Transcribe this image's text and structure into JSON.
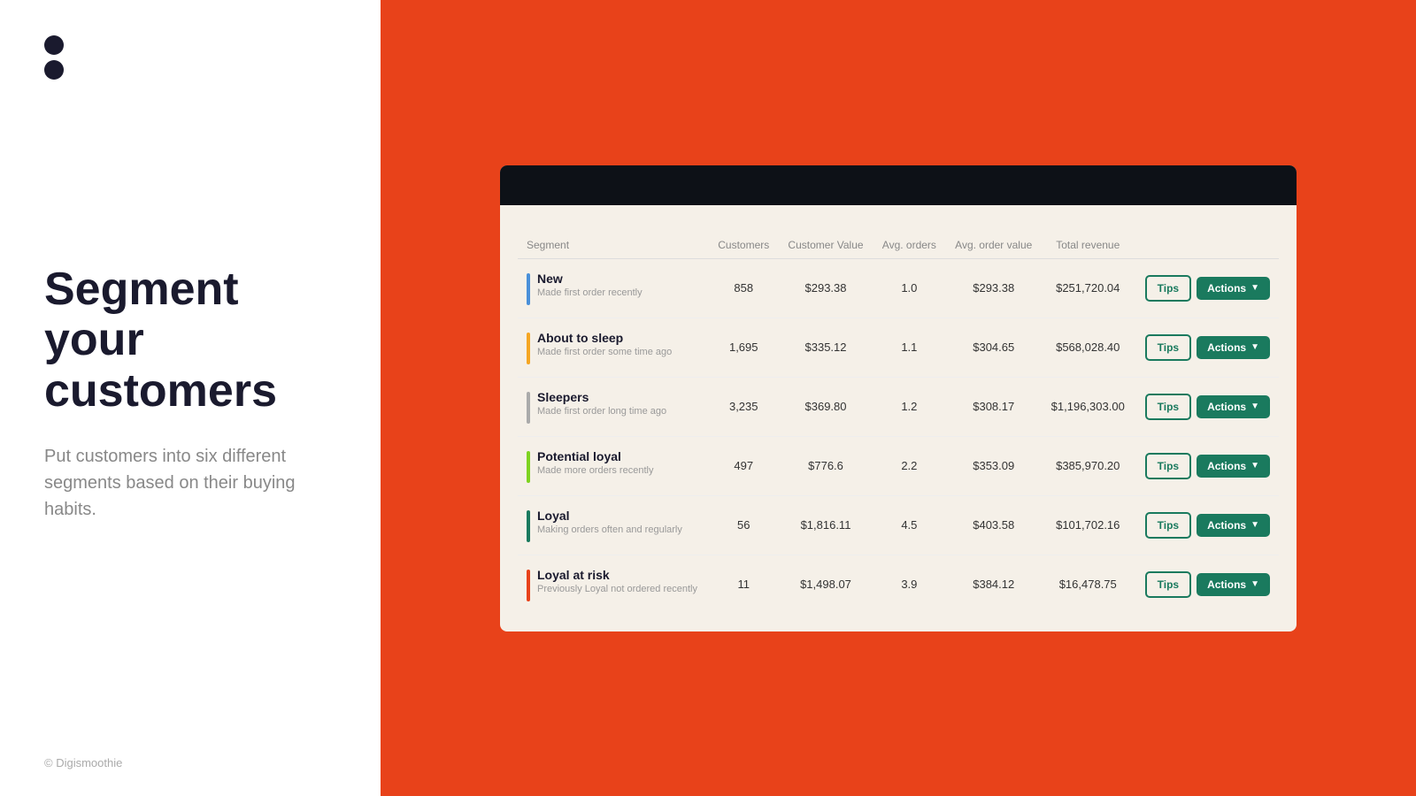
{
  "left": {
    "logo_alt": "Digismoothie logo",
    "heading": "Segment your customers",
    "subtext": "Put customers into six different segments based on their buying habits.",
    "footer": "© Digismoothie"
  },
  "table": {
    "columns": [
      "Segment",
      "Customers",
      "Customer Value",
      "Avg. orders",
      "Avg. order value",
      "Total revenue"
    ],
    "rows": [
      {
        "name": "New",
        "desc": "Made first order recently",
        "color": "#4a90d9",
        "customers": "858",
        "customer_value": "$293.38",
        "avg_orders": "1.0",
        "avg_order_value": "$293.38",
        "total_revenue": "$251,720.04"
      },
      {
        "name": "About to sleep",
        "desc": "Made first order some time ago",
        "color": "#f5a623",
        "customers": "1,695",
        "customer_value": "$335.12",
        "avg_orders": "1.1",
        "avg_order_value": "$304.65",
        "total_revenue": "$568,028.40"
      },
      {
        "name": "Sleepers",
        "desc": "Made first order long time ago",
        "color": "#aaa",
        "customers": "3,235",
        "customer_value": "$369.80",
        "avg_orders": "1.2",
        "avg_order_value": "$308.17",
        "total_revenue": "$1,196,303.00"
      },
      {
        "name": "Potential loyal",
        "desc": "Made more orders recently",
        "color": "#7ed321",
        "customers": "497",
        "customer_value": "$776.6",
        "avg_orders": "2.2",
        "avg_order_value": "$353.09",
        "total_revenue": "$385,970.20"
      },
      {
        "name": "Loyal",
        "desc": "Making orders often and regularly",
        "color": "#1a7a5e",
        "customers": "56",
        "customer_value": "$1,816.11",
        "avg_orders": "4.5",
        "avg_order_value": "$403.58",
        "total_revenue": "$101,702.16"
      },
      {
        "name": "Loyal at risk",
        "desc": "Previously Loyal not ordered recently",
        "color": "#e8421a",
        "customers": "11",
        "customer_value": "$1,498.07",
        "avg_orders": "3.9",
        "avg_order_value": "$384.12",
        "total_revenue": "$16,478.75"
      }
    ],
    "tips_label": "Tips",
    "actions_label": "Actions"
  }
}
